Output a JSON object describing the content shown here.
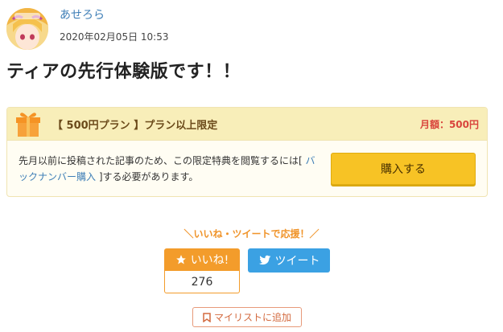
{
  "author": {
    "name": "あせろら",
    "date": "2020年02月05日 10:53"
  },
  "post": {
    "title": "ティアの先行体験版です！！"
  },
  "plan": {
    "name": "【 500円プラン 】プラン以上限定",
    "price": "月額：500円",
    "description_before": "先月以前に投稿された記事のため、この限定特典を閲覧するには[ ",
    "description_link": "バックナンバー購入",
    "description_after": " ]する必要があります。",
    "buy_label": "購入する"
  },
  "support": {
    "text": "＼いいね・ツイートで応援！／",
    "like_label": "いいね!",
    "like_count": "276",
    "tweet_label": "ツイート",
    "mylist_label": "マイリストに追加"
  },
  "colors": {
    "accent_orange": "#f39c2b",
    "twitter_blue": "#3ba1e3",
    "buy_yellow": "#f7c325",
    "price_red": "#d9443c",
    "link_blue": "#3f7fb7"
  }
}
